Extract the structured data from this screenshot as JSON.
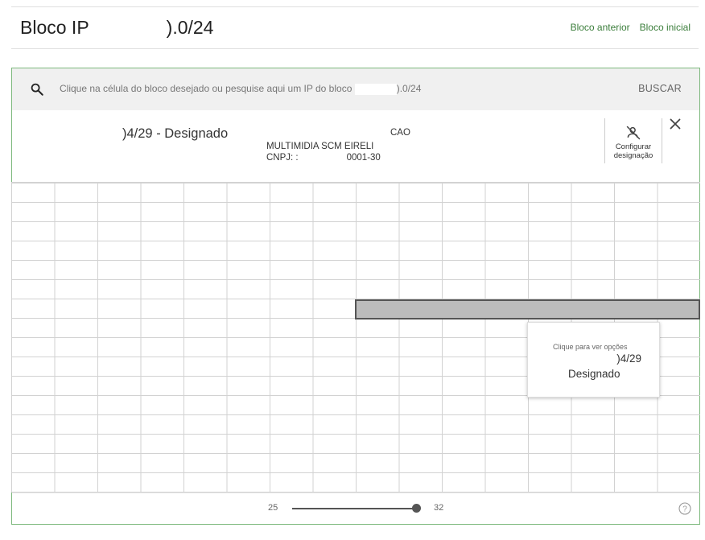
{
  "header": {
    "title_prefix": "Bloco IP",
    "title_suffix": ").0/24",
    "links": [
      "Bloco anterior",
      "Bloco inicial"
    ]
  },
  "search": {
    "text_prefix": "Clique na célula do bloco desejado ou pesquise aqui um IP do bloco",
    "text_suffix": ").0/24",
    "button_label": "BUSCAR"
  },
  "detail": {
    "title": ")4/29 - Designado",
    "owner_name": "MULTIMIDIA SCM EIRELI",
    "cnpj_prefix": "CNPJ: :",
    "cnpj_suffix": "0001-30",
    "tag": "CAO",
    "config_label_1": "Configurar",
    "config_label_2": "designação"
  },
  "tooltip": {
    "hint": "Clique para ver opções",
    "address": ")4/29",
    "status": "Designado"
  },
  "slider": {
    "min_label": "25",
    "max_label": "32",
    "value": 32
  },
  "icons": {
    "search": "search-icon",
    "config": "person-off-icon",
    "close": "close-icon",
    "help": "help-icon"
  },
  "colors": {
    "accent_green": "#3a7d3a",
    "panel_border": "#7cb87c",
    "selected_fill": "#bcbcbc"
  }
}
